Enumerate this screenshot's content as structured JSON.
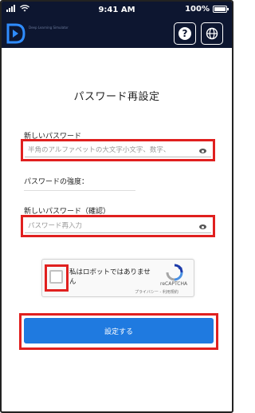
{
  "status_bar": {
    "time": "9:41 AM",
    "battery": "100%"
  },
  "header": {
    "logo_text": "Deep Learning Simulator",
    "help_label": "?"
  },
  "page": {
    "title": "パスワード再設定"
  },
  "new_password": {
    "label": "新しいパスワード",
    "placeholder": "半角のアルファベットの大文字小文字、数字、"
  },
  "strength": {
    "label": "パスワードの強度："
  },
  "confirm_password": {
    "label": "新しいパスワード（確認）",
    "placeholder": "パスワード再入力"
  },
  "captcha": {
    "text": "私はロボットではありません",
    "brand": "reCAPTCHA",
    "links": "プライバシー - 利用規約"
  },
  "submit": {
    "label": "設定する"
  },
  "colors": {
    "header_bg": "#0d1630",
    "accent": "#1f7ae0",
    "highlight": "#e0201f"
  }
}
